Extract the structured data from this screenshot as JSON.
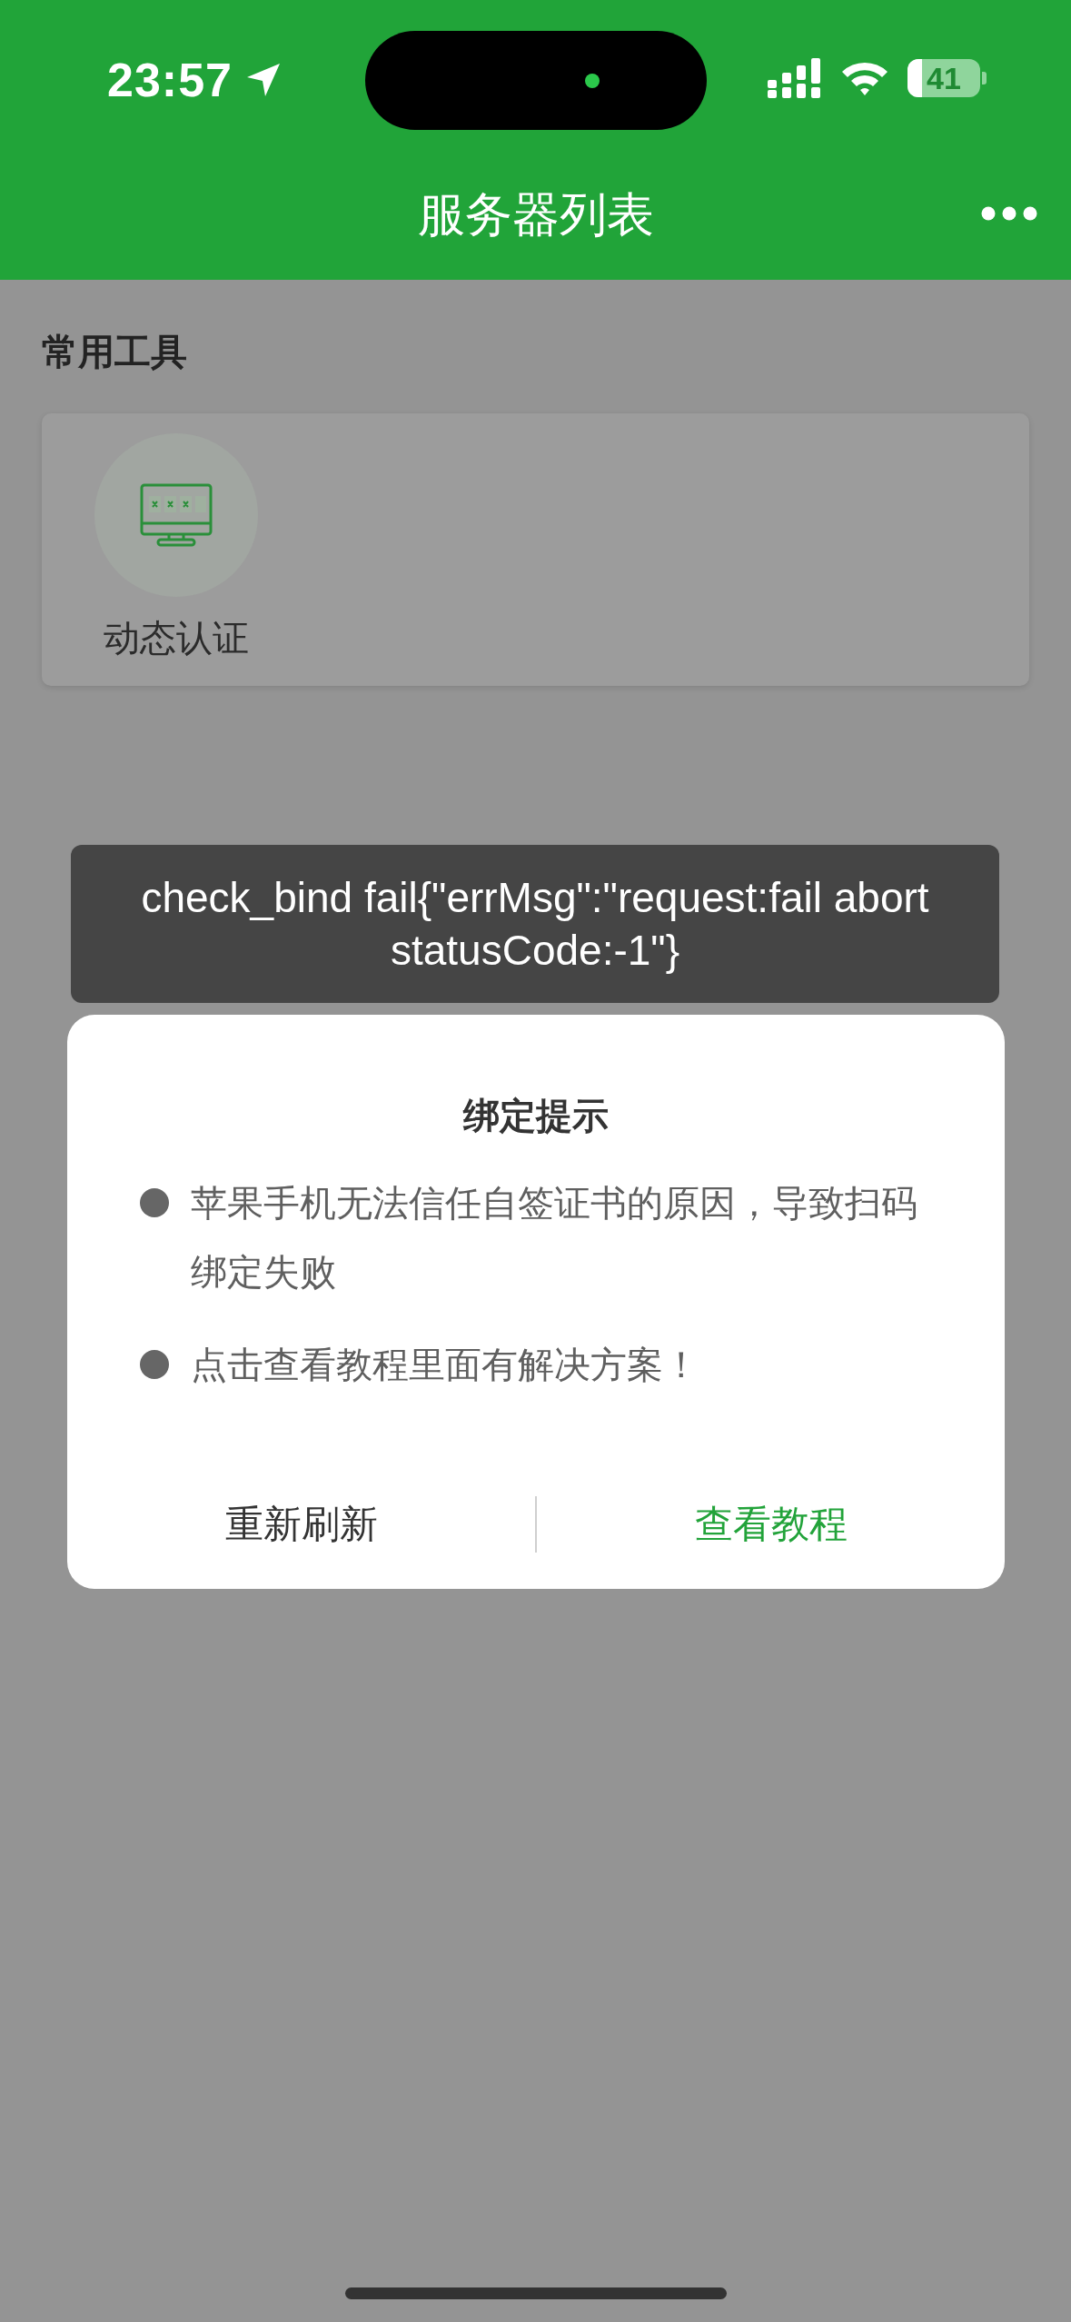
{
  "status_bar": {
    "time": "23:57",
    "battery": "41"
  },
  "nav_bar": {
    "title": "服务器列表"
  },
  "tools": {
    "title": "常用工具",
    "items": [
      {
        "label": "动态认证"
      }
    ]
  },
  "dialog": {
    "title": "绑定提示",
    "bullets": [
      "苹果手机无法信任自签证书的原因，导致扫码绑定失败",
      "点击查看教程里面有解决方案！"
    ],
    "buttons": [
      {
        "label": "重新刷新",
        "kind": "cancel"
      },
      {
        "label": "查看教程",
        "kind": "confirm"
      }
    ]
  },
  "toast": {
    "message": "check_bind fail{\"errMsg\":\"request:fail abort statusCode:-1\"}"
  }
}
